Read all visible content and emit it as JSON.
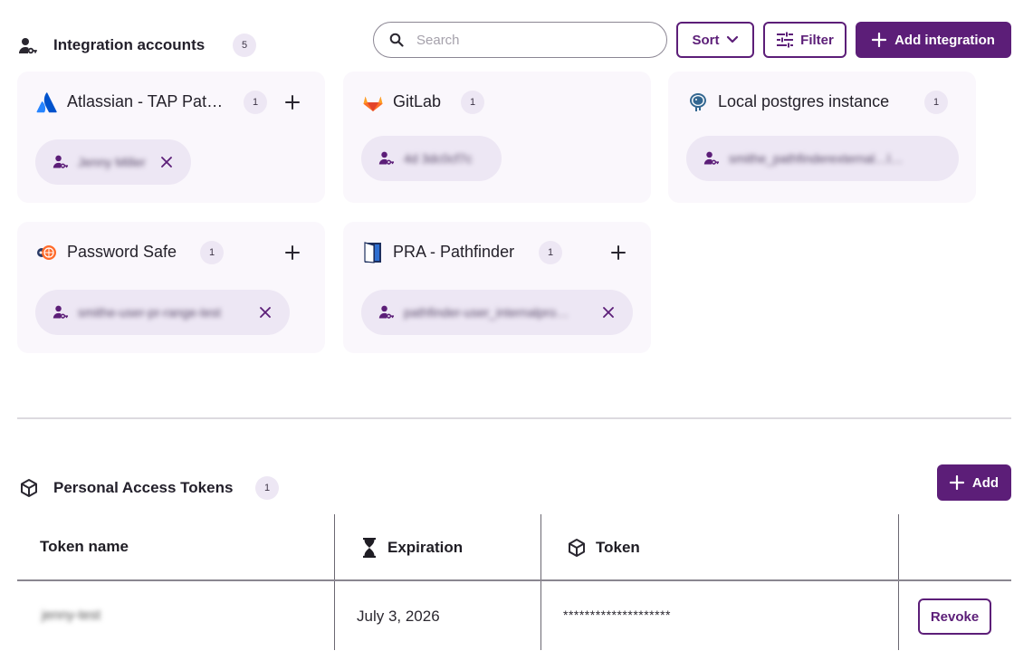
{
  "integrations": {
    "title": "Integration accounts",
    "count": "5",
    "search_placeholder": "Search",
    "sort_label": "Sort",
    "filter_label": "Filter",
    "add_label": "Add integration",
    "cards": [
      {
        "name": "Atlassian - TAP Pat…",
        "count": "1",
        "account": "Jenny Miller",
        "logo": "atlassian-logo"
      },
      {
        "name": "GitLab",
        "count": "1",
        "account": "4d 3dc0cf7c",
        "logo": "gitlab-logo"
      },
      {
        "name": "Local postgres instance",
        "count": "1",
        "account": "smithe_pathfinderexternal…l…",
        "logo": "postgres-logo"
      },
      {
        "name": "Password Safe",
        "count": "1",
        "account": "smithe-user-pr-range-test",
        "logo": "password-safe-logo"
      },
      {
        "name": "PRA - Pathfinder",
        "count": "1",
        "account": "pathfinder-user_internalpro…",
        "logo": "pra-logo"
      }
    ]
  },
  "tokens": {
    "title": "Personal Access Tokens",
    "count": "1",
    "add_label": "Add",
    "columns": [
      "Token name",
      "Expiration",
      "Token"
    ],
    "rows": [
      {
        "name": "jenny-test",
        "expiration": "July 3, 2026",
        "token": "********************",
        "action": "Revoke"
      }
    ]
  },
  "colors": {
    "brand": "#5c1e78",
    "chip": "#ede7f4",
    "card": "#faf7fc"
  }
}
